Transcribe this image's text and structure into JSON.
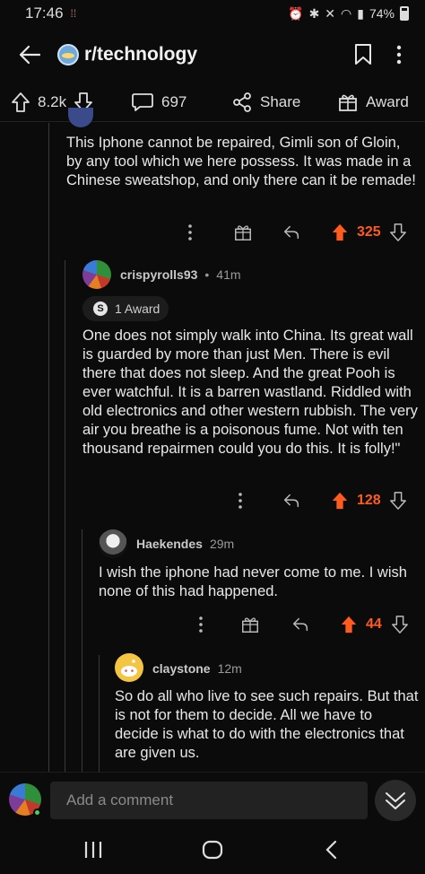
{
  "status": {
    "time": "17:46",
    "battery": "74%"
  },
  "header": {
    "subreddit": "r/technology"
  },
  "actions": {
    "upvotes": "8.2k",
    "comments": "697",
    "share": "Share",
    "award": "Award"
  },
  "comments": [
    {
      "body": "This Iphone cannot be repaired, Gimli son of Gloin, by any tool which we here possess. It was made in a Chinese sweatshop, and only there can it be remade!",
      "score": "325"
    },
    {
      "author": "crispyrolls93",
      "time": "41m",
      "award": "1 Award",
      "body": "One does not simply walk into China. Its great wall is guarded by more than just Men. There is evil there that does not sleep. And the great Pooh is ever watchful. It is a barren wastland. Riddled with old electronics and other western rubbish. The very air you breathe is a poisonous fume. Not with ten thousand repairmen could you do this. It is folly!\"",
      "score": "128"
    },
    {
      "author": "Haekendes",
      "time": "29m",
      "body": "I wish the iphone had never come to me. I wish none of this had happened.",
      "score": "44"
    },
    {
      "author": "claystone",
      "time": "12m",
      "body": "So do all who live to see such repairs. But that is not for them to decide. All we have to decide is what to do with the electronics that are given us."
    }
  ],
  "composer": {
    "placeholder": "Add a comment"
  },
  "colors": {
    "upvote": "#ff5b1f",
    "background": "#0b0b0b"
  }
}
